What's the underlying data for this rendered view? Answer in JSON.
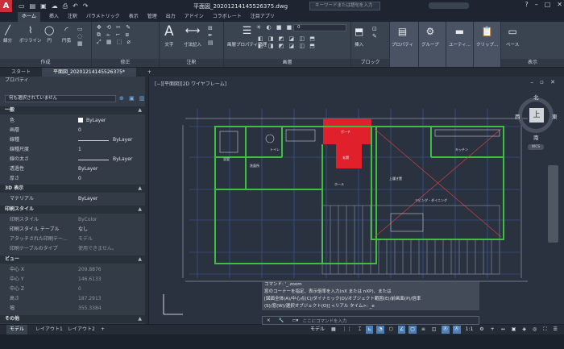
{
  "titlebar": {
    "app_logo": "A",
    "title": "平面図_20201214145526375.dwg",
    "search_placeholder": "キーワードまたは語句を入力"
  },
  "ribbon_tabs": [
    "ホーム",
    "挿入",
    "注釈",
    "パラメトリック",
    "表示",
    "管理",
    "出力",
    "アドイン",
    "コラボレート",
    "注目アプリ"
  ],
  "ribbon": {
    "draw": {
      "title": "作成",
      "tools": [
        "線分",
        "ポリライン",
        "円",
        "円弧"
      ]
    },
    "modify": {
      "title": "修正"
    },
    "annotation": {
      "title": "注釈",
      "tools": [
        "文字",
        "寸法記入"
      ]
    },
    "layers": {
      "title": "画層",
      "tools": [
        "画層プロパティ管理"
      ],
      "current_layer": "0"
    },
    "block": {
      "title": "ブロック",
      "tools": [
        "挿入"
      ]
    },
    "properties": {
      "tools": [
        "プロパティ"
      ]
    },
    "groups": {
      "tools": [
        "グループ"
      ]
    },
    "utilities": {
      "tools": [
        "ユーティ..."
      ]
    },
    "clipboard": {
      "tools": [
        "クリップ..."
      ]
    },
    "view": {
      "title": "表示",
      "tools": [
        "ベース"
      ]
    }
  },
  "doc_tabs": [
    "スタート",
    "平面図_20201214145526375*"
  ],
  "properties_panel": {
    "title": "プロパティ",
    "selection": "何も選択されていません",
    "sections": [
      {
        "name": "一般",
        "rows": [
          {
            "key": "色",
            "value": "ByLayer"
          },
          {
            "key": "画層",
            "value": "0"
          },
          {
            "key": "線種",
            "value": "ByLayer"
          },
          {
            "key": "線種尺度",
            "value": "1"
          },
          {
            "key": "線の太さ",
            "value": "ByLayer"
          },
          {
            "key": "透過性",
            "value": "ByLayer"
          },
          {
            "key": "厚さ",
            "value": "0"
          }
        ]
      },
      {
        "name": "3D 表示",
        "rows": [
          {
            "key": "マテリアル",
            "value": "ByLayer"
          }
        ]
      },
      {
        "name": "印刷スタイル",
        "rows": [
          {
            "key": "印刷スタイル",
            "value": "ByColor"
          },
          {
            "key": "印刷スタイル テーブル",
            "value": "なし"
          },
          {
            "key": "アタッチされた印刷テー...",
            "value": "モデル"
          },
          {
            "key": "印刷テーブルのタイプ",
            "value": "使用できません。"
          }
        ]
      },
      {
        "name": "ビュー",
        "rows": [
          {
            "key": "中心 X",
            "value": "209.8876"
          },
          {
            "key": "中心 Y",
            "value": "146.6133"
          },
          {
            "key": "中心 Z",
            "value": "0"
          },
          {
            "key": "高さ",
            "value": "187.2913"
          },
          {
            "key": "幅",
            "value": "355.3384"
          }
        ]
      },
      {
        "name": "その他",
        "rows": []
      }
    ]
  },
  "viewport": {
    "label": "[−][平面図][2D ワイヤフレーム]",
    "room_labels": [
      "ポーチ",
      "玄関",
      "キッチン",
      "ホール",
      "リビング・ダイニング",
      "上履き置",
      "トイレ",
      "浴室",
      "洗面所"
    ]
  },
  "viewcube": {
    "north": "北",
    "south": "南",
    "east": "東",
    "west": "西",
    "top": "上",
    "wcs": "WCS"
  },
  "command": {
    "history": [
      "コマンド: '_.zoom",
      "窓のコーナーを指定、表示倍率を入力(nX または nXP)、または",
      "[図面全体(A)/中心点(C)/ダイナミック(D)/オブジェクト範囲(E)/前画面(P)/倍率",
      "(S)/窓(W)/選択オブジェクト(O)] <リアル タイム>: _e"
    ],
    "placeholder": "ここにコマンドを入力"
  },
  "layout_tabs": [
    "モデル",
    "レイアウト1",
    "レイアウト2"
  ],
  "status": {
    "model_label": "モデル",
    "scale": "1:1"
  },
  "colors": {
    "accent": "#4d7fb4",
    "wall": "#3fbf3f",
    "porch": "#e0202a",
    "bg": "#2a3240"
  }
}
